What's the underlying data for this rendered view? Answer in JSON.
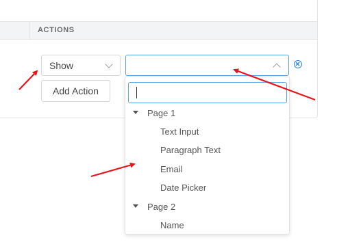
{
  "table": {
    "header_actions": "ACTIONS"
  },
  "rule": {
    "show_select": {
      "value": "Show"
    },
    "target_select": {
      "value": ""
    },
    "add_action_label": "Add Action"
  },
  "dropdown": {
    "search_value": "",
    "groups": [
      {
        "label": "Page 1",
        "options": [
          "Text Input",
          "Paragraph Text",
          "Email",
          "Date Picker"
        ]
      },
      {
        "label": "Page 2",
        "options": [
          "Name"
        ]
      }
    ]
  },
  "colors": {
    "accent": "#2a86d6",
    "annotation_arrow": "#e8141c"
  }
}
